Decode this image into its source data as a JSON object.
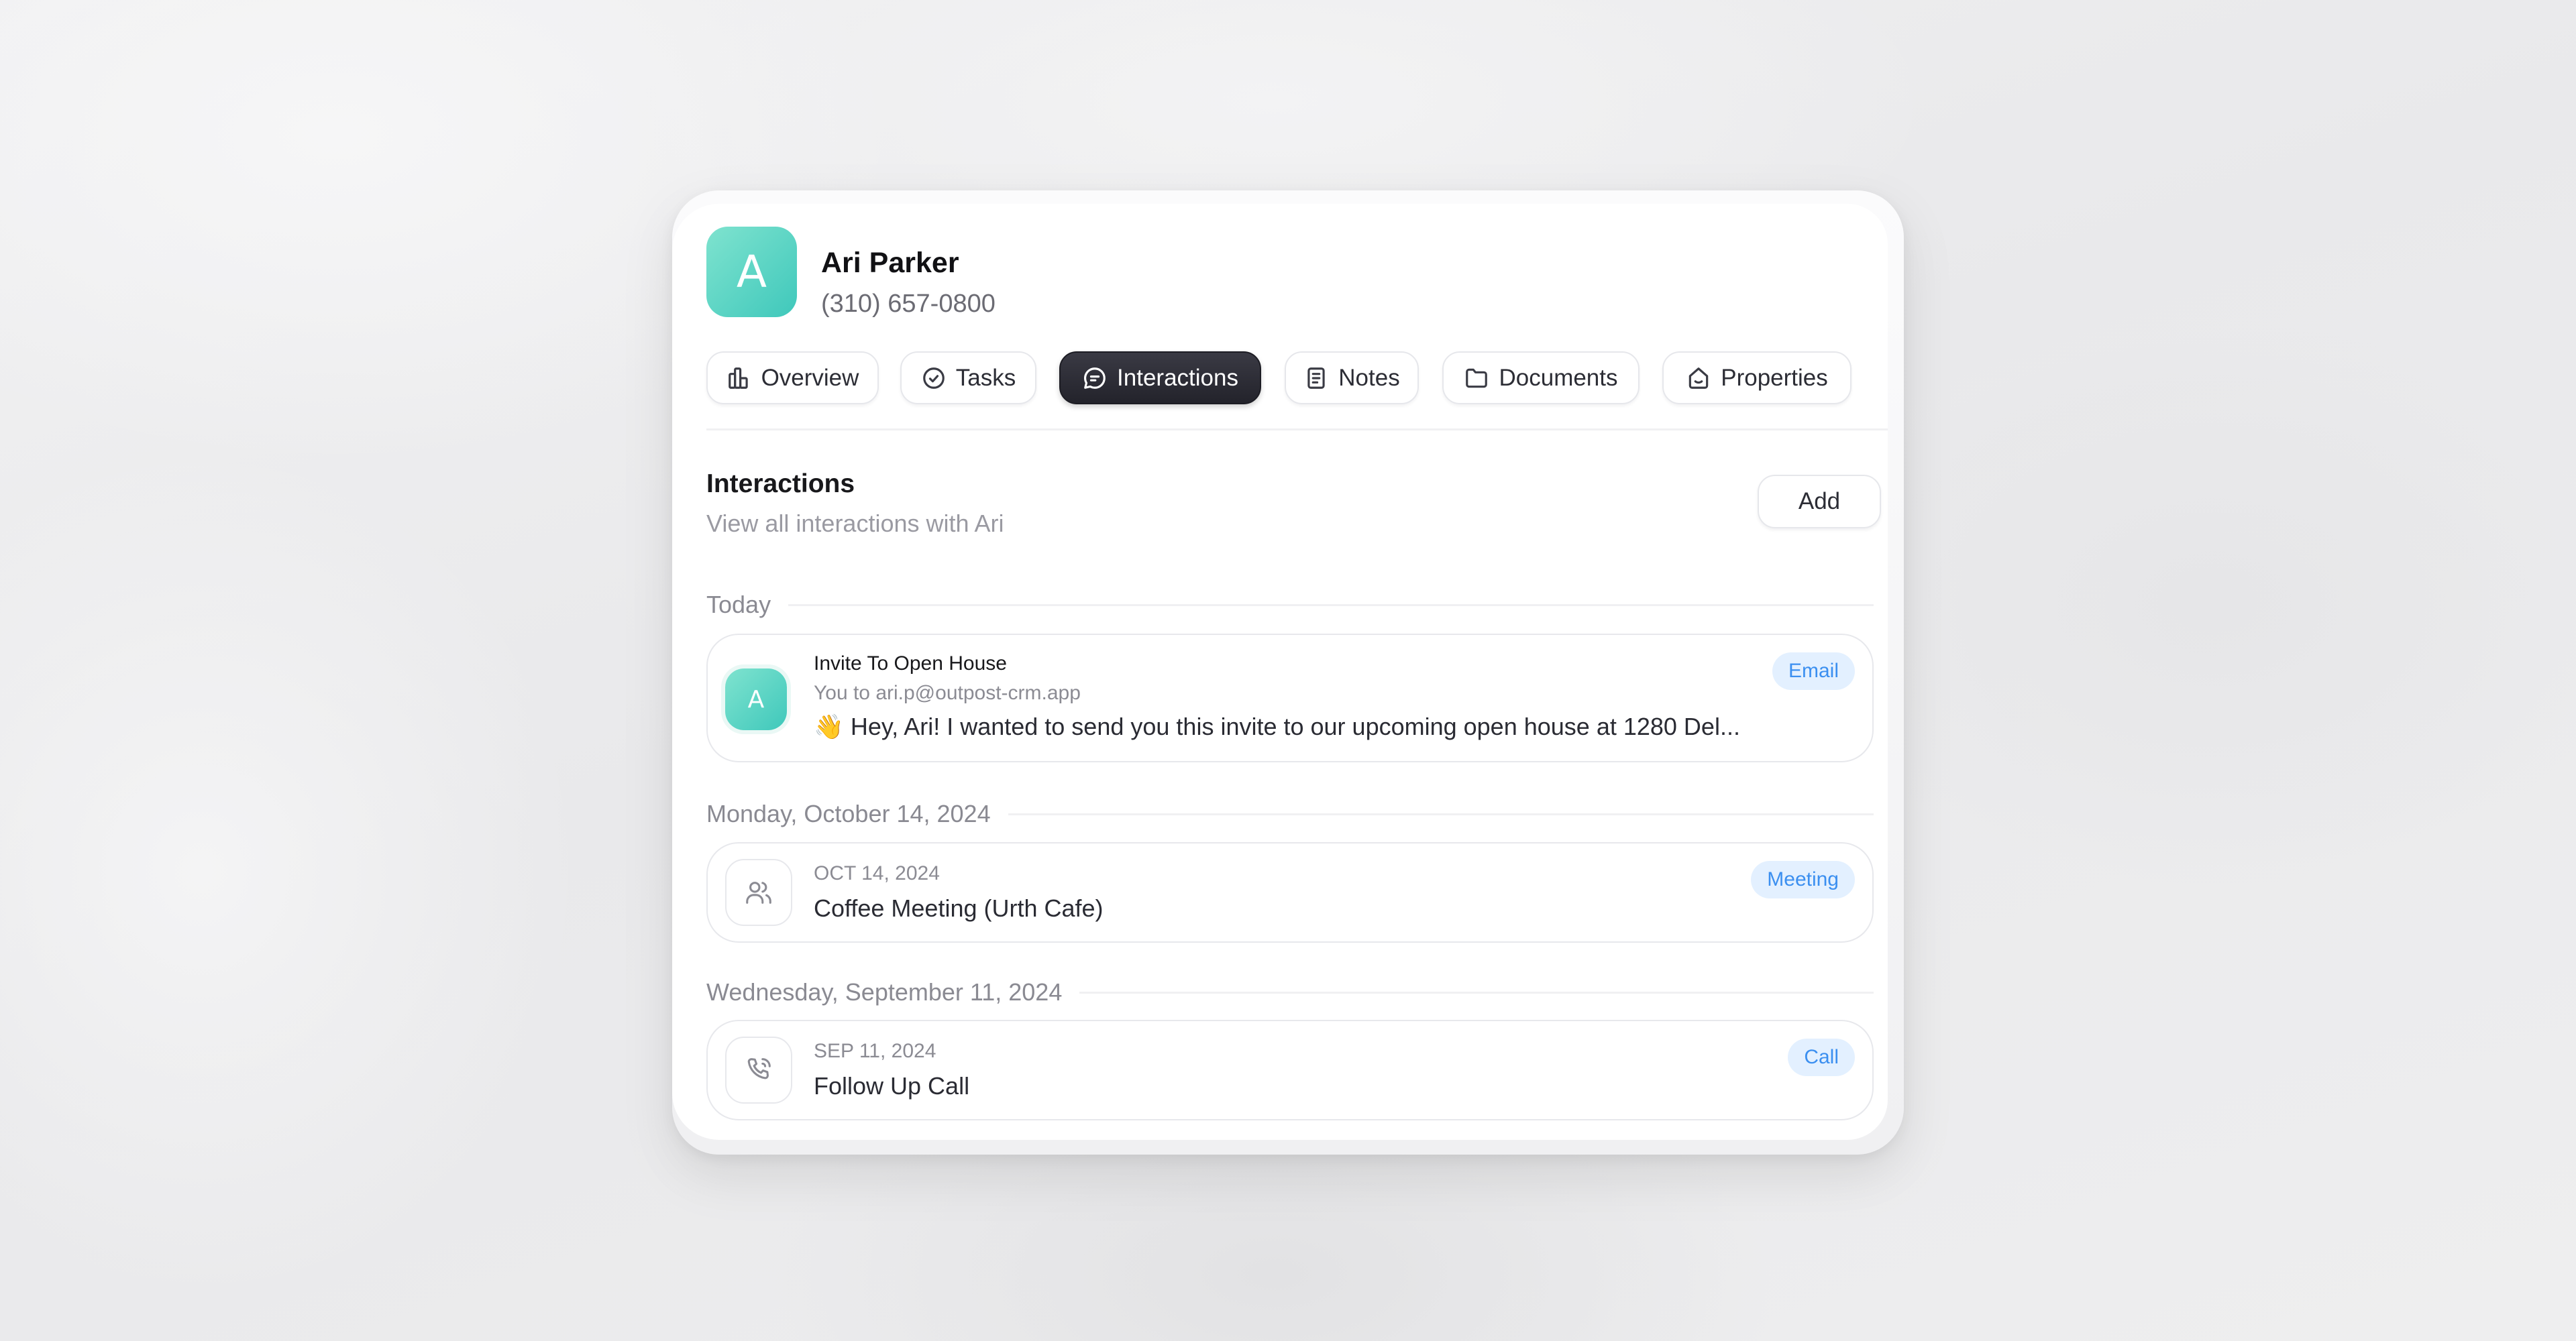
{
  "contact": {
    "initial": "A",
    "name": "Ari Parker",
    "phone": "(310) 657-0800"
  },
  "tabs": [
    {
      "label": "Overview",
      "icon": "bar-chart-icon",
      "active": false
    },
    {
      "label": "Tasks",
      "icon": "check-circle-icon",
      "active": false
    },
    {
      "label": "Interactions",
      "icon": "chat-bubble-icon",
      "active": true
    },
    {
      "label": "Notes",
      "icon": "notes-icon",
      "active": false
    },
    {
      "label": "Documents",
      "icon": "folder-icon",
      "active": false
    },
    {
      "label": "Properties",
      "icon": "house-icon",
      "active": false
    }
  ],
  "section": {
    "title": "Interactions",
    "subtitle": "View all interactions with Ari",
    "add_label": "Add"
  },
  "groups": [
    {
      "label": "Today",
      "items": [
        {
          "type": "Email",
          "avatar_initial": "A",
          "title": "Invite To Open House",
          "from": "You to ari.p@outpost-crm.app",
          "preview": "👋 Hey, Ari! I wanted to send you this invite to our upcoming open house at 1280 Del..."
        }
      ]
    },
    {
      "label": "Monday, October 14, 2024",
      "items": [
        {
          "type": "Meeting",
          "icon": "users-icon",
          "date": "OCT 14, 2024",
          "name": "Coffee Meeting (Urth Cafe)"
        }
      ]
    },
    {
      "label": "Wednesday, September 11, 2024",
      "items": [
        {
          "type": "Call",
          "icon": "phone-call-icon",
          "date": "SEP 11, 2024",
          "name": "Follow Up Call"
        }
      ]
    }
  ],
  "colors": {
    "accent_teal": "#3fc8bb",
    "active_tab": "#23232b",
    "badge_bg": "#e3f0ff",
    "badge_text": "#3b8ff0"
  }
}
